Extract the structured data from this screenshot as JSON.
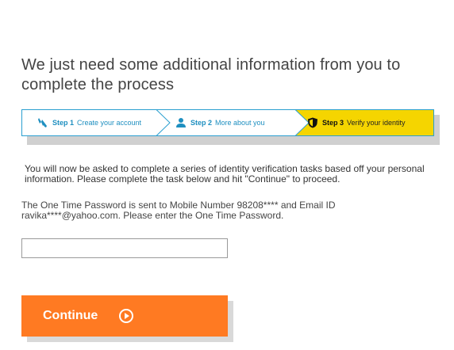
{
  "page": {
    "title": "We just need some additional information from you to complete the process"
  },
  "stepper": {
    "steps": [
      {
        "number": "Step 1",
        "label": "Create your account",
        "icon": "key-pen-icon",
        "state": "inactive"
      },
      {
        "number": "Step 2",
        "label": "More about you",
        "icon": "person-icon",
        "state": "inactive"
      },
      {
        "number": "Step 3",
        "label": "Verify your identity",
        "icon": "shield-icon",
        "state": "active"
      }
    ]
  },
  "content": {
    "intro": "You will now be asked to complete a series of identity verification tasks based off your personal information. Please complete the task below and hit \"Continue\" to proceed.",
    "otp_message": "The One Time Password is sent to Mobile Number 98208**** and Email ID ravika****@yahoo.com. Please enter the One Time Password."
  },
  "otp_input": {
    "value": "",
    "placeholder": ""
  },
  "continue_button": {
    "label": "Continue",
    "icon": "play-circle-icon"
  },
  "colors": {
    "accent_orange": "#ff7a22",
    "step_active_yellow": "#f5d500",
    "step_blue": "#1e8fc0",
    "step_border": "#2a9fd0"
  }
}
